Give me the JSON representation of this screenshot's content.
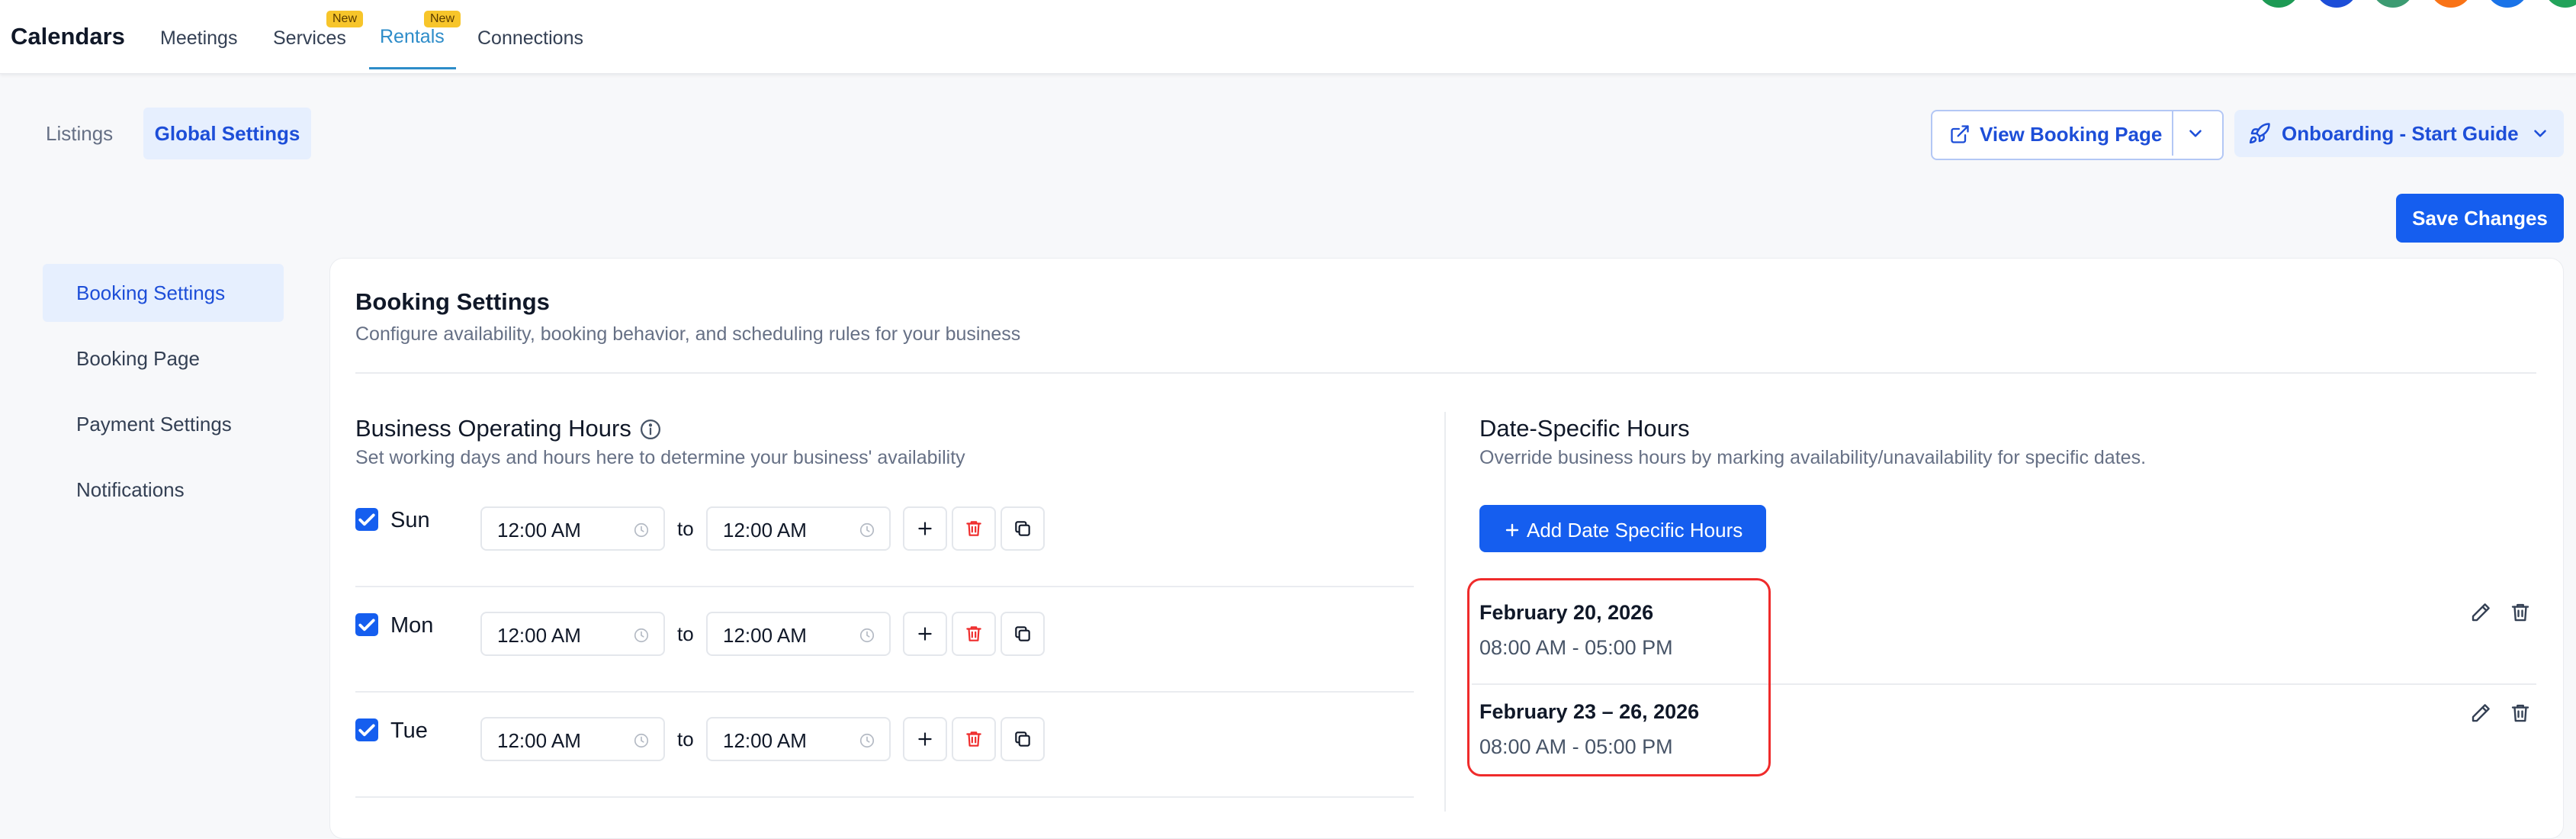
{
  "app": {
    "title": "Calendars"
  },
  "nav": {
    "tabs": [
      {
        "label": "Meetings",
        "badge": ""
      },
      {
        "label": "Services",
        "badge": "New"
      },
      {
        "label": "Rentals",
        "badge": "New"
      },
      {
        "label": "Connections",
        "badge": ""
      }
    ],
    "active_tab": "Rentals",
    "avatar_colors": [
      "#1d9a54",
      "#1d4ed8",
      "#3c9b72",
      "#f97316",
      "#1a73e8",
      "#22a35a"
    ]
  },
  "subtabs": {
    "items": [
      "Listings",
      "Global Settings"
    ],
    "active": "Global Settings"
  },
  "header_actions": {
    "view_booking": "View Booking Page",
    "onboarding": "Onboarding - Start Guide",
    "save": "Save Changes"
  },
  "sidebar": {
    "items": [
      "Booking Settings",
      "Booking Page",
      "Payment Settings",
      "Notifications"
    ],
    "active": "Booking Settings"
  },
  "booking_settings": {
    "title": "Booking Settings",
    "subtitle": "Configure availability, booking behavior, and scheduling rules for your business"
  },
  "operating_hours": {
    "title": "Business Operating Hours",
    "subtitle": "Set working days and hours here to determine your business' availability",
    "to_label": "to",
    "days": [
      {
        "name": "Sun",
        "checked": true,
        "start": "12:00 AM",
        "end": "12:00 AM"
      },
      {
        "name": "Mon",
        "checked": true,
        "start": "12:00 AM",
        "end": "12:00 AM"
      },
      {
        "name": "Tue",
        "checked": true,
        "start": "12:00 AM",
        "end": "12:00 AM"
      }
    ]
  },
  "date_specific": {
    "title": "Date-Specific Hours",
    "subtitle": "Override business hours by marking availability/unavailability for specific dates.",
    "add_button": "Add Date Specific Hours",
    "entries": [
      {
        "date": "February 20, 2026",
        "hours": "08:00 AM - 05:00 PM"
      },
      {
        "date": "February 23 – 26, 2026",
        "hours": "08:00 AM - 05:00 PM"
      }
    ]
  },
  "colors": {
    "primary": "#155eef",
    "accent": "#2d8cc9",
    "danger": "#ef2b2b",
    "badge": "#f7c52a"
  }
}
